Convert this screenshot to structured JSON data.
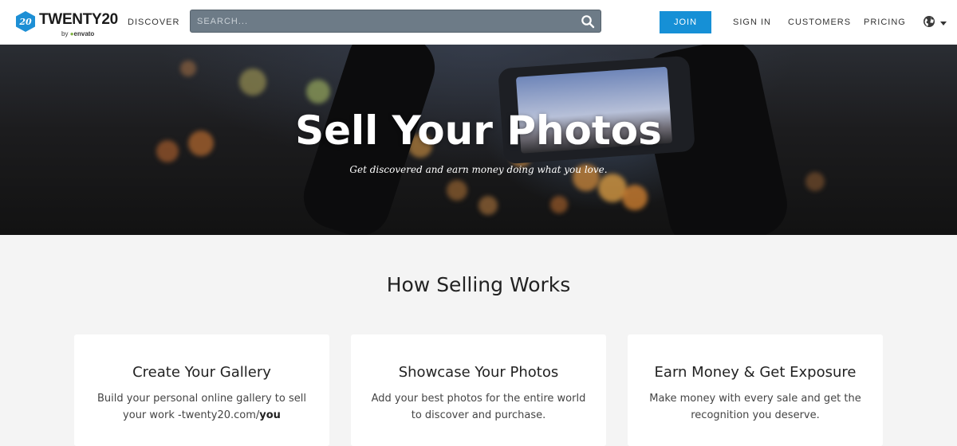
{
  "header": {
    "logo_text": "TWENTY20",
    "logo_badge": "20",
    "logo_by": "by",
    "logo_brand": "envato",
    "nav_discover": "DISCOVER",
    "search_placeholder": "SEARCH...",
    "join": "JOIN",
    "sign_in": "SIGN IN",
    "customers": "CUSTOMERS",
    "pricing": "PRICING",
    "icons": {
      "search": "search-icon",
      "globe": "globe-icon",
      "dropdown": "caret-down-icon"
    },
    "colors": {
      "join_bg": "#1690d6",
      "search_bg": "#6d7b87",
      "logo_blue": "#1d8fd5"
    }
  },
  "hero": {
    "title": "Sell Your Photos",
    "subtitle": "Get discovered and earn money doing what you love."
  },
  "main": {
    "section_title": "How Selling Works",
    "cards": [
      {
        "title": "Create Your Gallery",
        "text": "Build your personal online gallery to sell your work -twenty20.com/",
        "text_bold": "you"
      },
      {
        "title": "Showcase Your Photos",
        "text": "Add your best photos for the entire world to discover and purchase."
      },
      {
        "title": "Earn Money & Get Exposure",
        "text": "Make money with every sale and get the recognition you deserve."
      }
    ]
  }
}
